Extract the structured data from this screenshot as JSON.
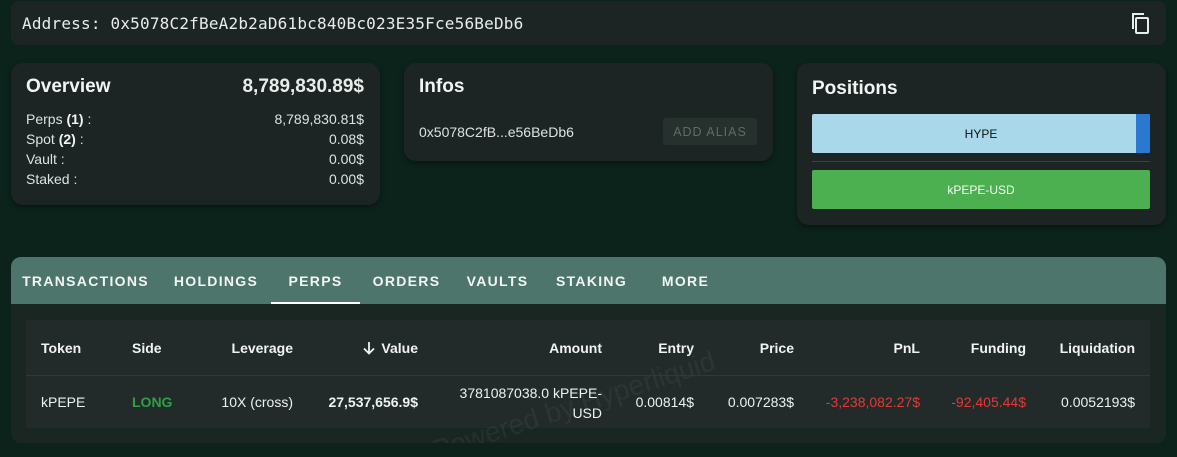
{
  "address": {
    "label": "Address: 0x5078C2fBeA2b2aD61bc840Bc023E35Fce56BeDb6",
    "copy_icon": "copy-icon"
  },
  "overview": {
    "title": "Overview",
    "total": "8,789,830.89$",
    "rows": [
      {
        "label": "Perps",
        "count": "(1)",
        "suffix": " :",
        "value": "8,789,830.81$"
      },
      {
        "label": "Spot",
        "count": "(2)",
        "suffix": " :",
        "value": "0.08$"
      },
      {
        "label": "Vault :",
        "count": "",
        "suffix": "",
        "value": "0.00$"
      },
      {
        "label": "Staked :",
        "count": "",
        "suffix": "",
        "value": "0.00$"
      }
    ]
  },
  "infos": {
    "title": "Infos",
    "short_address": "0x5078C2fB...e56BeDb6",
    "alias_button": "ADD ALIAS"
  },
  "positions": {
    "title": "Positions",
    "items": [
      {
        "label": "HYPE",
        "color": "#a9d8ea"
      },
      {
        "label": "kPEPE-USD",
        "color": "#4caf50"
      }
    ]
  },
  "tabs": [
    {
      "label": "TRANSACTIONS",
      "active": false
    },
    {
      "label": "HOLDINGS",
      "active": false
    },
    {
      "label": "PERPS",
      "active": true
    },
    {
      "label": "ORDERS",
      "active": false
    },
    {
      "label": "VAULTS",
      "active": false
    },
    {
      "label": "STAKING",
      "active": false
    },
    {
      "label": "MORE",
      "active": false
    }
  ],
  "table": {
    "headers": {
      "token": "Token",
      "side": "Side",
      "leverage": "Leverage",
      "value": "Value",
      "amount": "Amount",
      "entry": "Entry",
      "price": "Price",
      "pnl": "PnL",
      "funding": "Funding",
      "liquidation": "Liquidation"
    },
    "sort_icon": "arrow-down-icon",
    "rows": [
      {
        "token": "kPEPE",
        "side": "LONG",
        "leverage": "10X (cross)",
        "value": "27,537,656.9$",
        "amount_line1": "3781087038.0 kPEPE-",
        "amount_line2": "USD",
        "entry": "0.00814$",
        "price": "0.007283$",
        "pnl": "-3,238,082.27$",
        "funding": "-92,405.44$",
        "liquidation": "0.0052193$"
      }
    ],
    "watermark": "Powered by Hyperliquid"
  },
  "colors": {
    "background": "#0c231c",
    "card": "#1c2523",
    "tab_bar": "#4e756b",
    "long": "#2ea043",
    "negative": "#e53935"
  }
}
